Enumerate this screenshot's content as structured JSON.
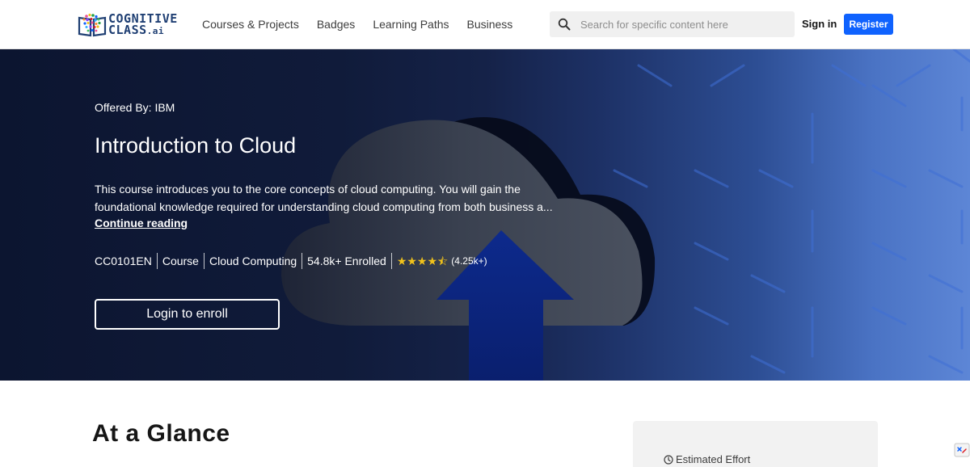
{
  "header": {
    "logo": {
      "line1": "COGNITIVE",
      "line2": "CLASS",
      "suffix": ".ai"
    },
    "nav": [
      "Courses & Projects",
      "Badges",
      "Learning Paths",
      "Business"
    ],
    "search": {
      "placeholder": "Search for specific content here",
      "value": ""
    },
    "signin_label": "Sign in",
    "register_label": "Register"
  },
  "hero": {
    "offered_by": "Offered By: IBM",
    "title": "Introduction to Cloud",
    "description_lines": [
      "This course introduces you to the core concepts of cloud computing. You will gain the",
      "foundational knowledge required for understanding cloud computing from both business a..."
    ],
    "continue_label": "Continue reading",
    "meta": {
      "code": "CC0101EN",
      "type": "Course",
      "topic": "Cloud Computing",
      "enrolled": "54.8k+ Enrolled",
      "rating_stars": "★★★★⯪",
      "rating_count": "(4.25k+)",
      "rating_value": 4.5
    },
    "enroll_label": "Login to enroll"
  },
  "glance": {
    "heading": "At a Glance",
    "estimated_effort_label": "Estimated Effort"
  },
  "colors": {
    "brand_blue": "#0f62fe",
    "logo_navy": "#1f3f73",
    "star_gold": "#f1c21b",
    "hero_dark": "#0c1530",
    "hero_light": "#5d86d6"
  },
  "icons": {
    "search": "search-icon",
    "clock": "clock-icon",
    "logo": "cognitive-class-logo-icon",
    "hero_art": "cloud-upload-illustration"
  }
}
